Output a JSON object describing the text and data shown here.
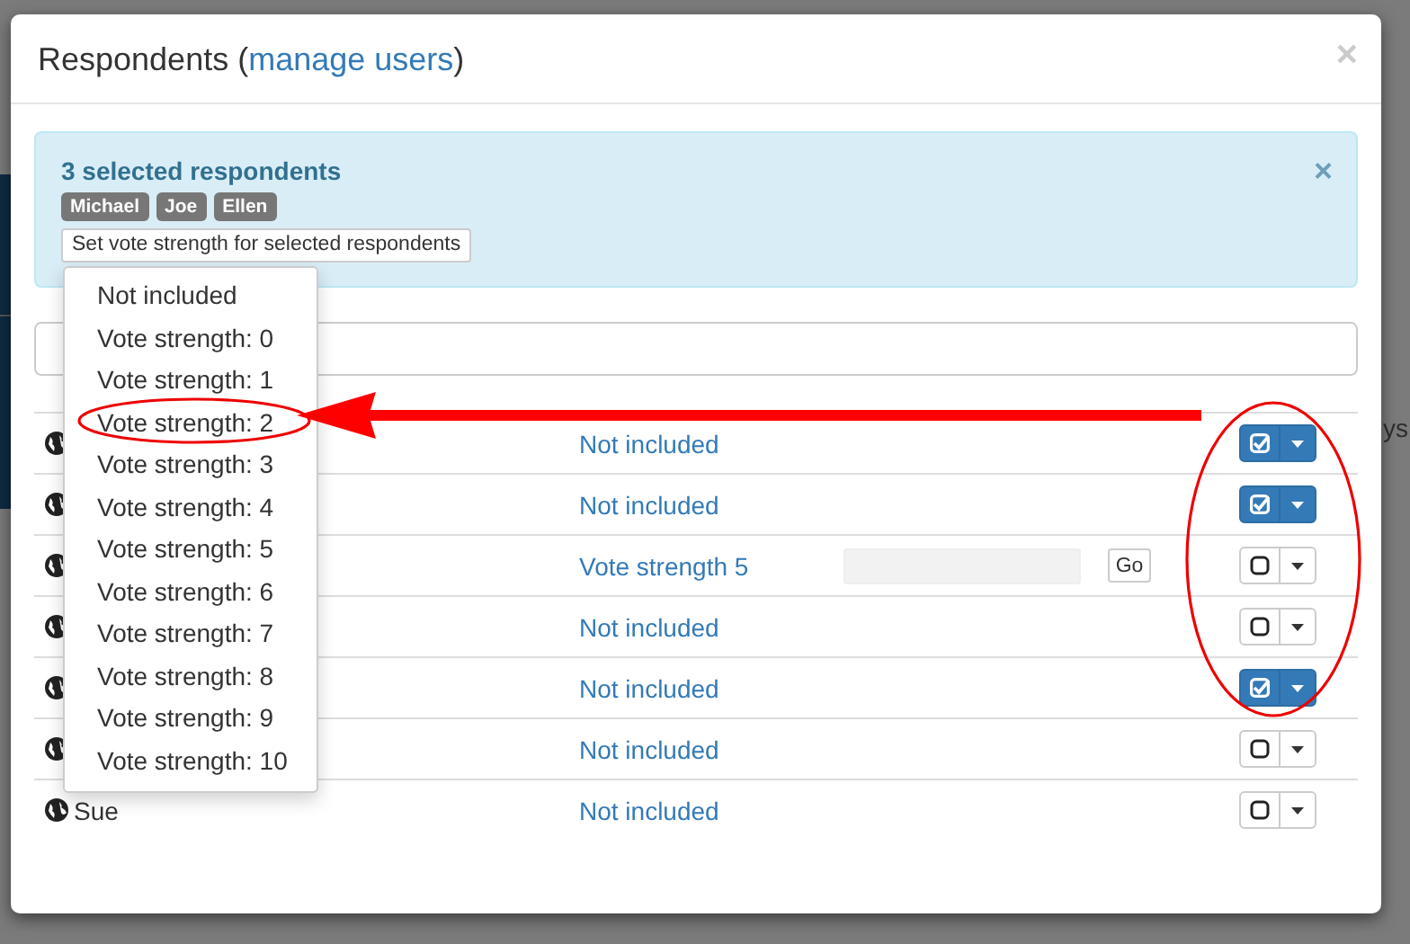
{
  "background": {
    "texts": [
      "ys"
    ]
  },
  "modal": {
    "title": "Respondents (",
    "title_link": "manage users",
    "title_end": ")",
    "close": "×"
  },
  "alert": {
    "heading": "3 selected respondents",
    "tags": [
      "Michael",
      "Joe",
      "Ellen"
    ],
    "action_button": "Set vote strength for selected respondents",
    "close": "×"
  },
  "rows": [
    {
      "status": "Not included",
      "selected": true
    },
    {
      "status": "Not included",
      "selected": true
    },
    {
      "status": "Vote strength 5",
      "selected": false,
      "go_button": "Go"
    },
    {
      "status": "Not included",
      "selected": false
    },
    {
      "status": "Not included",
      "selected": true
    },
    {
      "status": "Not included",
      "selected": false
    },
    {
      "name": "Sue",
      "status": "Not included",
      "selected": false
    }
  ],
  "dropdown": {
    "items": [
      "Not included",
      "Vote strength: 0",
      "Vote strength: 1",
      "Vote strength: 2",
      "Vote strength: 3",
      "Vote strength: 4",
      "Vote strength: 5",
      "Vote strength: 6",
      "Vote strength: 7",
      "Vote strength: 8",
      "Vote strength: 9",
      "Vote strength: 10"
    ]
  }
}
